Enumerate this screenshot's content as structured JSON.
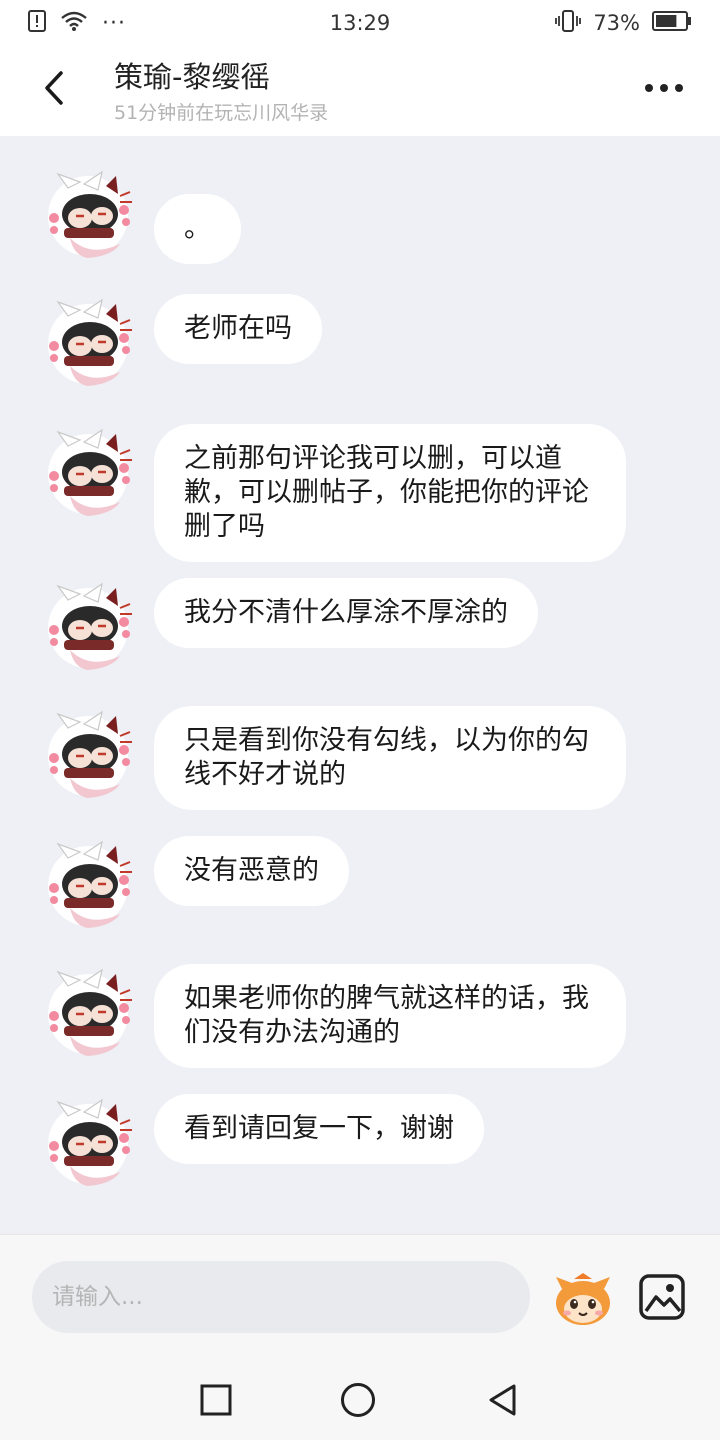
{
  "status_bar": {
    "time": "13:29",
    "battery_percent": "73%",
    "battery_level": 0.73,
    "more_dots": "···",
    "icons": [
      "sim-alert-icon",
      "wifi-icon",
      "vibrate-icon",
      "battery-icon"
    ]
  },
  "header": {
    "title": "策瑜-黎缨徭",
    "subtitle": "51分钟前在玩忘川风华录",
    "icons": [
      "back-arrow-icon",
      "more-options-icon"
    ]
  },
  "messages": [
    {
      "text": "。"
    },
    {
      "text": "老师在吗"
    },
    {
      "text": "之前那句评论我可以删，可以道歉，可以删帖子，你能把你的评论删了吗"
    },
    {
      "text": "我分不清什么厚涂不厚涂的"
    },
    {
      "text": "只是看到你没有勾线，以为你的勾线不好才说的"
    },
    {
      "text": "没有恶意的"
    },
    {
      "text": "如果老师你的脾气就这样的话，我们没有办法沟通的"
    },
    {
      "text": "看到请回复一下，谢谢"
    }
  ],
  "input": {
    "placeholder": "请输入...",
    "value": "",
    "icons": [
      "emoji-face-icon",
      "image-picker-icon"
    ]
  },
  "nav_bar": {
    "icons": [
      "recents-square-icon",
      "home-circle-icon",
      "back-triangle-icon"
    ]
  },
  "colors": {
    "chat_background": "#eef0f5",
    "bubble": "#ffffff",
    "subtitle": "#b3b3b3",
    "input_background": "#e9eaee",
    "emoji_orange": "#f39a3b"
  }
}
